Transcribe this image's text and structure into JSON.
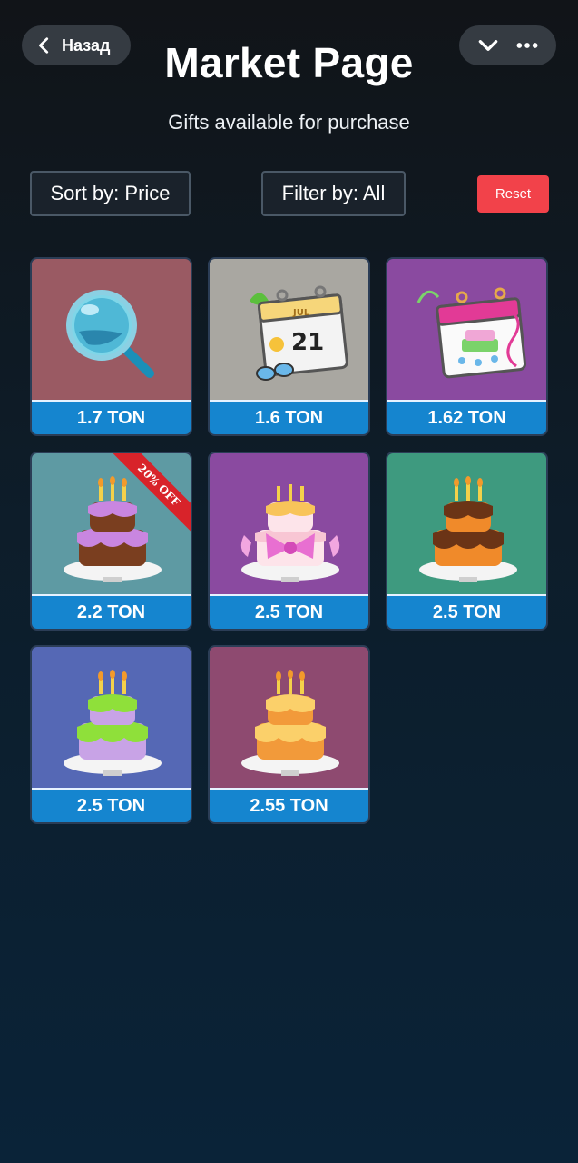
{
  "nav": {
    "back_label": "Назад"
  },
  "header": {
    "title": "Market Page",
    "subtitle": "Gifts available for purchase"
  },
  "controls": {
    "sort_label": "Sort by: Price",
    "filter_label": "Filter by: All",
    "reset_label": "Reset"
  },
  "gifts": [
    {
      "item": "magnifier",
      "price": "1.7 TON",
      "bg": "#9a5a63"
    },
    {
      "item": "calendar",
      "price": "1.6 TON",
      "bg": "#a9a7a1",
      "calendar_month": "JUL",
      "calendar_day": "21"
    },
    {
      "item": "party-calendar",
      "price": "1.62 TON",
      "bg": "#8a4aa0"
    },
    {
      "item": "cake-purple-chocolate",
      "price": "2.2 TON",
      "bg": "#5e9aa3",
      "badge": "20% OFF"
    },
    {
      "item": "cake-pink-bow",
      "price": "2.5 TON",
      "bg": "#8a4aa0"
    },
    {
      "item": "cake-chocolate-orange",
      "price": "2.5 TON",
      "bg": "#3e9a7f"
    },
    {
      "item": "cake-green-lilac",
      "price": "2.5 TON",
      "bg": "#5568b5"
    },
    {
      "item": "cake-yellow-orange",
      "price": "2.55 TON",
      "bg": "#8e4a70"
    }
  ],
  "colors": {
    "price_bar": "#1585cf",
    "reset": "#f2424a",
    "ribbon": "#d8232a"
  }
}
